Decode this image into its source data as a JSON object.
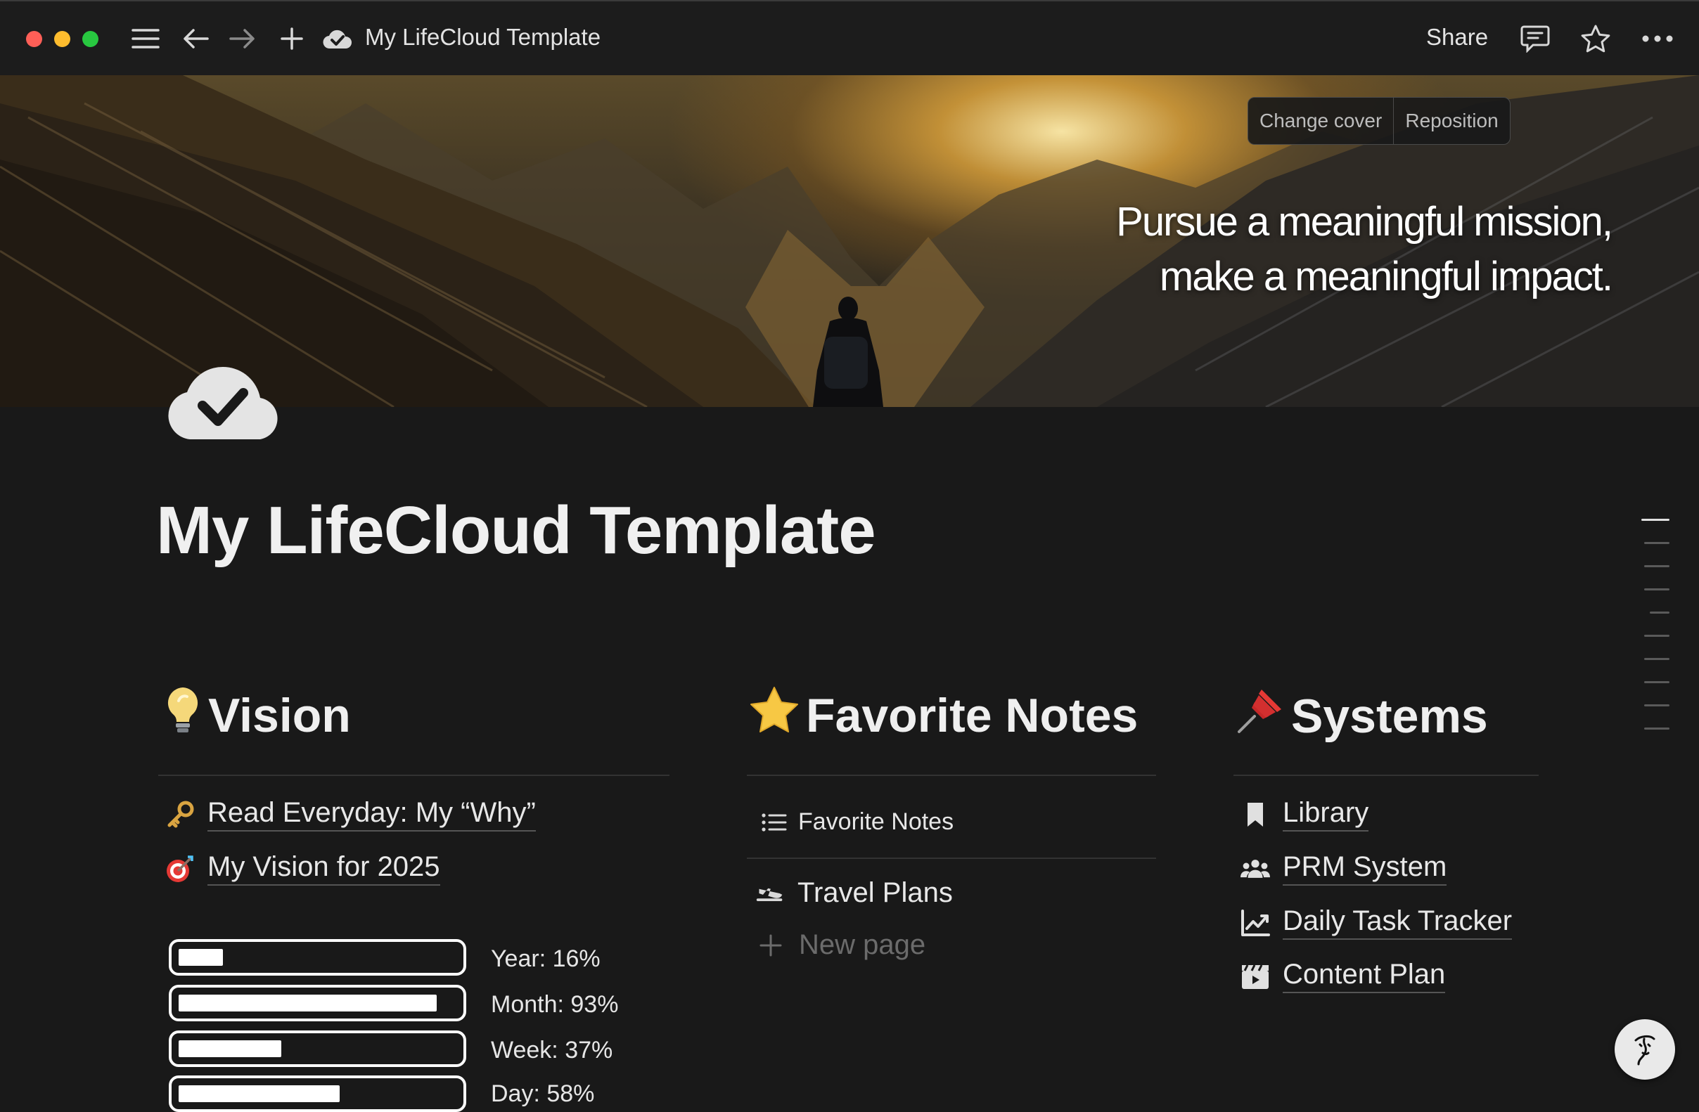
{
  "titlebar": {
    "breadcrumb_title": "My LifeCloud Template",
    "share_label": "Share",
    "icons": [
      "sidebar-menu-icon",
      "back-arrow-icon",
      "forward-arrow-icon",
      "plus-icon",
      "cloud-check-icon",
      "comment-icon",
      "star-icon",
      "more-icon"
    ]
  },
  "cover": {
    "quote_line1": "Pursue a meaningful mission,",
    "quote_line2": "make a meaningful impact.",
    "change_cover_label": "Change cover",
    "reposition_label": "Reposition"
  },
  "page": {
    "title": "My LifeCloud Template",
    "icon": "cloud-check-icon"
  },
  "vision": {
    "heading": "Vision",
    "heading_emoji": "💡",
    "links": [
      {
        "emoji": "🔑",
        "label": "Read Everyday: My “Why”"
      },
      {
        "emoji": "🎯",
        "label": "My Vision for 2025"
      }
    ],
    "progress": [
      {
        "label": "Year: 16%",
        "value": 0.16
      },
      {
        "label": "Month: 93%",
        "value": 0.93
      },
      {
        "label": "Week: 37%",
        "value": 0.37
      },
      {
        "label": "Day: 58%",
        "value": 0.58
      }
    ]
  },
  "favorites": {
    "heading": "Favorite Notes",
    "heading_emoji": "⭐",
    "view_label": "Favorite Notes",
    "items": [
      {
        "label": "Travel Plans",
        "icon": "airplane-takeoff-icon"
      }
    ],
    "new_page_label": "New page"
  },
  "systems": {
    "heading": "Systems",
    "heading_emoji": "📌",
    "items": [
      {
        "label": "Library",
        "icon": "bookmark-icon"
      },
      {
        "label": "PRM System",
        "icon": "people-icon"
      },
      {
        "label": "Daily Task Tracker",
        "icon": "chart-line-icon"
      },
      {
        "label": "Content Plan",
        "icon": "clapperboard-icon"
      }
    ]
  },
  "colors": {
    "background": "#191919",
    "text": "#e6e6e6",
    "muted": "#6b6b6b"
  }
}
